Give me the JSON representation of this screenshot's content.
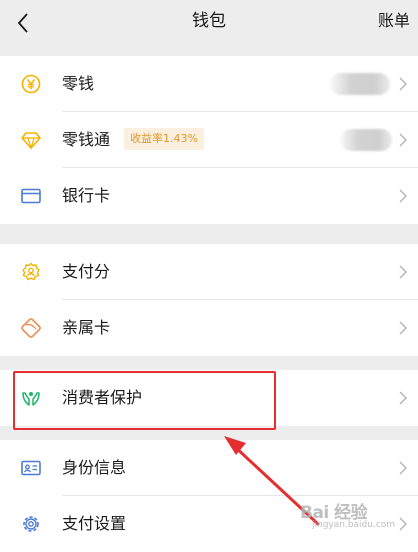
{
  "header": {
    "title": "钱包",
    "action": "账单",
    "back_icon": "chevron-left-icon"
  },
  "groups": [
    [
      {
        "name": "change",
        "label": "零钱",
        "icon": "yen-coin-icon",
        "masked": true
      },
      {
        "name": "lqt",
        "label": "零钱通",
        "icon": "diamond-icon",
        "badge": "收益率1.43%",
        "masked": true
      },
      {
        "name": "bank-card",
        "label": "银行卡",
        "icon": "bank-card-icon"
      }
    ],
    [
      {
        "name": "pay-score",
        "label": "支付分",
        "icon": "pay-score-icon"
      },
      {
        "name": "family-card",
        "label": "亲属卡",
        "icon": "family-card-icon"
      }
    ],
    [
      {
        "name": "consumer-protection",
        "label": "消费者保护",
        "icon": "hands-protect-icon",
        "highlighted": true
      }
    ],
    [
      {
        "name": "identity-info",
        "label": "身份信息",
        "icon": "id-card-icon"
      },
      {
        "name": "pay-settings",
        "label": "支付设置",
        "icon": "gear-icon"
      }
    ]
  ],
  "watermark": {
    "main": "Bai 经验",
    "sub": "jingyan.baidu.com"
  },
  "colors": {
    "accent_yellow": "#f5b300",
    "bank_blue": "#4a7bd3",
    "protect_green": "#24b36b",
    "highlight_red": "#e52e2e",
    "badge_bg": "#fbf0df",
    "badge_text": "#e0962c"
  }
}
